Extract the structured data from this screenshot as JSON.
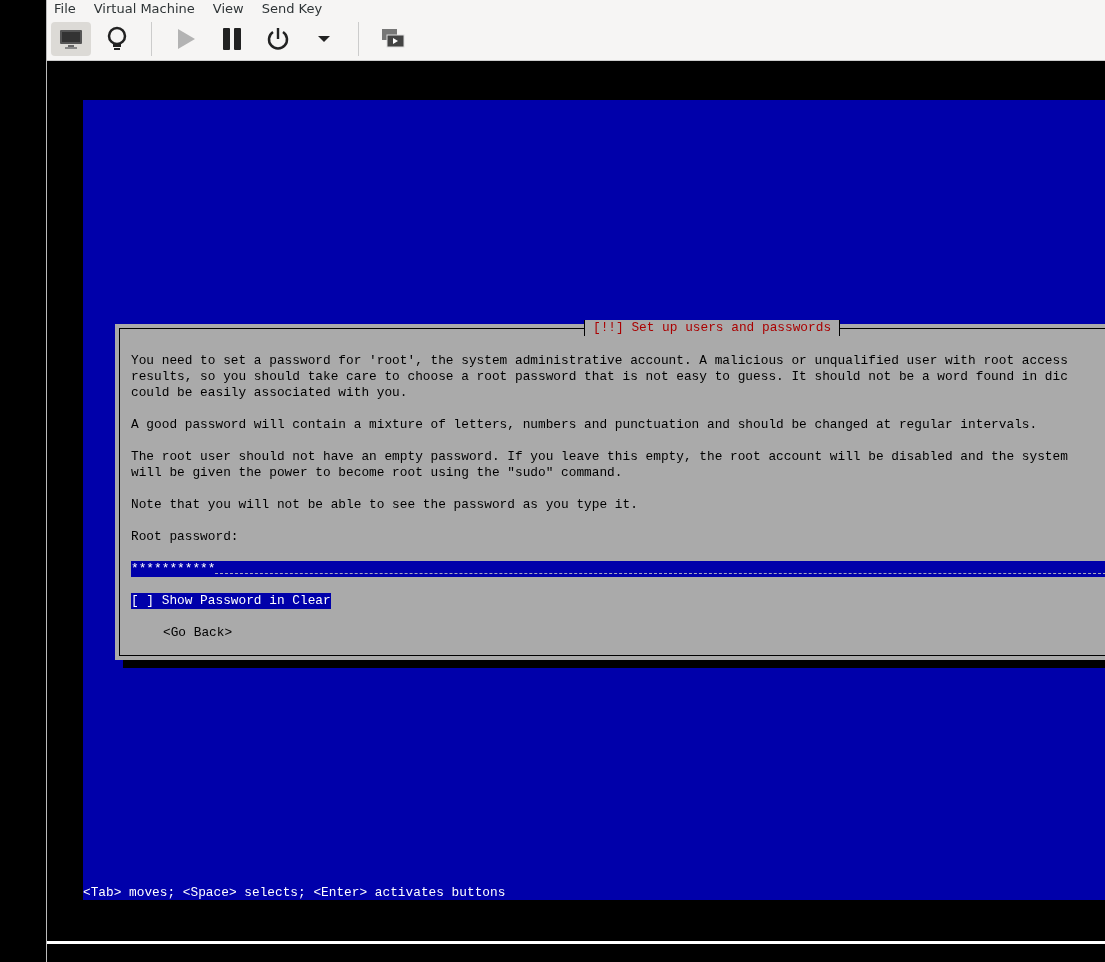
{
  "menu": [
    "File",
    "Virtual Machine",
    "View",
    "Send Key"
  ],
  "toolbar": [
    {
      "kind": "console",
      "selected": true,
      "disabled": false
    },
    {
      "kind": "details",
      "selected": false,
      "disabled": false
    },
    {
      "kind": "separator"
    },
    {
      "kind": "run",
      "selected": false,
      "disabled": true
    },
    {
      "kind": "pause",
      "selected": false,
      "disabled": false
    },
    {
      "kind": "power",
      "selected": false,
      "disabled": false
    },
    {
      "kind": "dropdown",
      "selected": false,
      "disabled": false
    },
    {
      "kind": "separator"
    },
    {
      "kind": "fullscreen",
      "selected": false,
      "disabled": false
    }
  ],
  "dialog": {
    "title": "[!!] Set up users and passwords",
    "paragraphs": [
      [
        "You need to set a password for 'root', the system administrative account. A malicious or unqualified user with root access",
        "results, so you should take care to choose a root password that is not easy to guess. It should not be a word found in dic",
        "could be easily associated with you."
      ],
      [
        "A good password will contain a mixture of letters, numbers and punctuation and should be changed at regular intervals."
      ],
      [
        "The root user should not have an empty password. If you leave this empty, the root account will be disabled and the system",
        "will be given the power to become root using the \"sudo\" command."
      ],
      [
        "Note that you will not be able to see the password as you type it."
      ]
    ],
    "field_label": "Root password:",
    "password": "***********",
    "show_password": {
      "label": "[ ] Show Password in Clear",
      "checked": false,
      "focused": true
    },
    "buttons": [
      "<Go Back>"
    ]
  },
  "help_line": "<Tab> moves; <Space> selects; <Enter> activates buttons"
}
